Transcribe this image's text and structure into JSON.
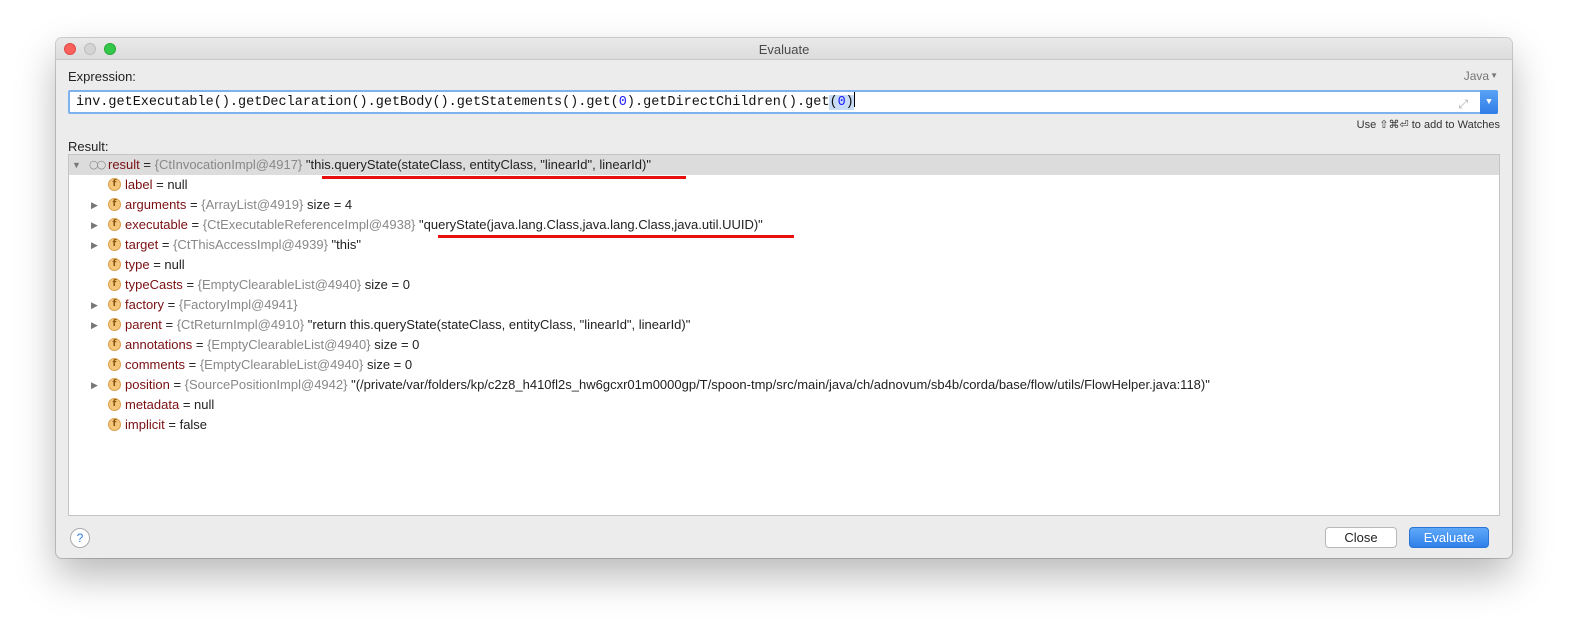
{
  "window": {
    "title": "Evaluate"
  },
  "expression": {
    "label": "Expression:",
    "language": "Java",
    "code_prefix": "inv.getExecutable().getDeclaration().getBody().getStatements().get(",
    "code_num1": "0",
    "code_middle": ").getDirectChildren().get",
    "code_hl_open": "(",
    "code_num2": "0",
    "code_hl_close": ")",
    "expand_icon": "expand-icon",
    "history_icon": "chevron-down-icon",
    "watches_hint": "Use ⇧⌘⏎ to add to Watches"
  },
  "result": {
    "label": "Result:",
    "rows": [
      {
        "name": "result",
        "ref": "{CtInvocationImpl@4917}",
        "value": "\"this.queryState(stateClass, entityClass, \"linearId\", linearId)\""
      },
      {
        "name": "label",
        "ref": "",
        "value": "null"
      },
      {
        "name": "arguments",
        "ref": "{ArrayList@4919}",
        "value": "size = 4"
      },
      {
        "name": "executable",
        "ref": "{CtExecutableReferenceImpl@4938}",
        "value": "\"queryState(java.lang.Class,java.lang.Class,java.util.UUID)\""
      },
      {
        "name": "target",
        "ref": "{CtThisAccessImpl@4939}",
        "value": "\"this\""
      },
      {
        "name": "type",
        "ref": "",
        "value": "null"
      },
      {
        "name": "typeCasts",
        "ref": "{EmptyClearableList@4940}",
        "value": "size = 0"
      },
      {
        "name": "factory",
        "ref": "{FactoryImpl@4941}",
        "value": ""
      },
      {
        "name": "parent",
        "ref": "{CtReturnImpl@4910}",
        "value": "\"return this.queryState(stateClass, entityClass, \"linearId\", linearId)\""
      },
      {
        "name": "annotations",
        "ref": "{EmptyClearableList@4940}",
        "value": "size = 0"
      },
      {
        "name": "comments",
        "ref": "{EmptyClearableList@4940}",
        "value": "size = 0"
      },
      {
        "name": "position",
        "ref": "{SourcePositionImpl@4942}",
        "value": "\"(/private/var/folders/kp/c2z8_h410fl2s_hw6gcxr01m0000gp/T/spoon-tmp/src/main/java/ch/adnovum/sb4b/corda/base/flow/utils/FlowHelper.java:118)\""
      },
      {
        "name": "metadata",
        "ref": "",
        "value": "null"
      },
      {
        "name": "implicit",
        "ref": "",
        "value": "false"
      }
    ],
    "field_badge": "f",
    "eq": "="
  },
  "footer": {
    "help_label": "?",
    "close_label": "Close",
    "evaluate_label": "Evaluate"
  },
  "colors": {
    "accent": "#2f80ea",
    "annotation": "#e8100e",
    "field_name": "#7a0f12"
  }
}
